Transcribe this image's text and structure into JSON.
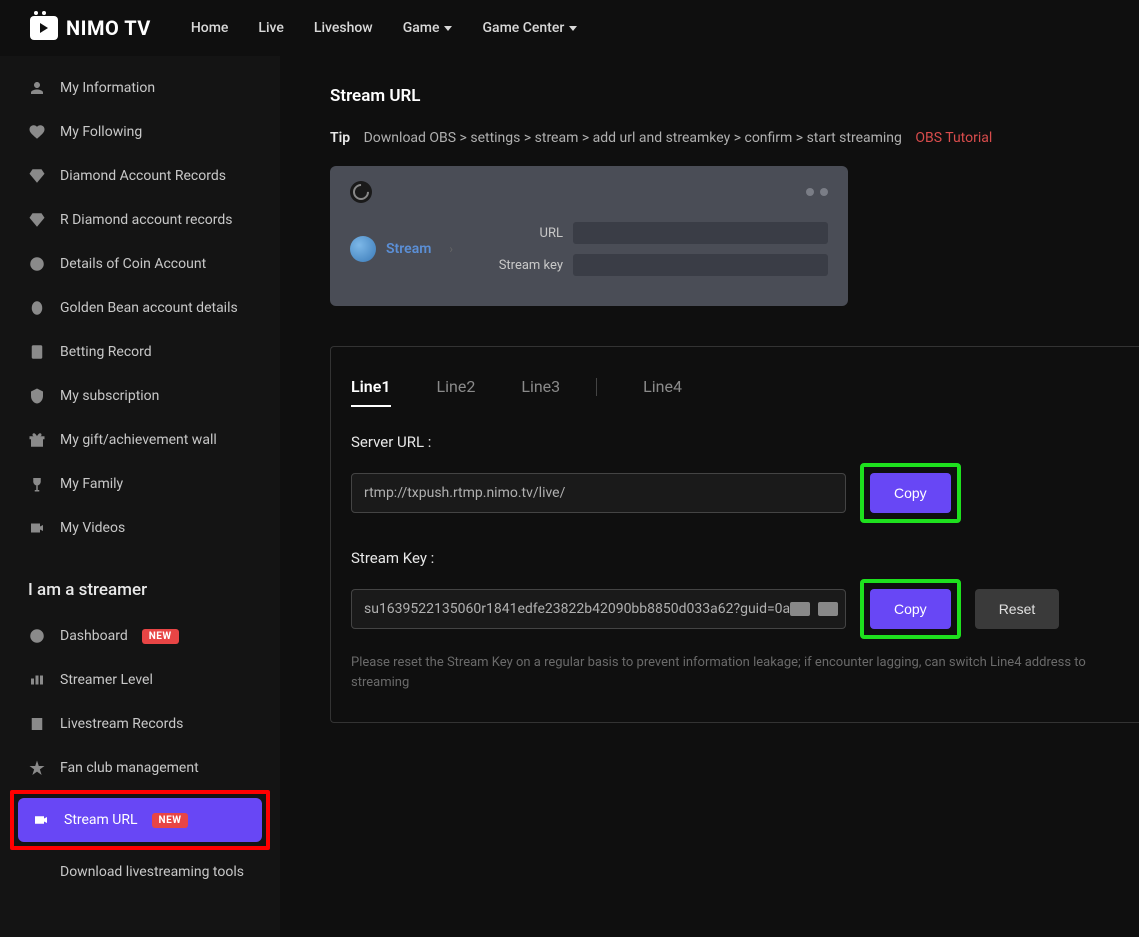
{
  "brand": "NIMO TV",
  "nav": {
    "home": "Home",
    "live": "Live",
    "liveshow": "Liveshow",
    "game": "Game",
    "game_center": "Game Center"
  },
  "sidebar": {
    "items": [
      {
        "label": "My Information"
      },
      {
        "label": "My Following"
      },
      {
        "label": "Diamond Account Records"
      },
      {
        "label": "R Diamond account records"
      },
      {
        "label": "Details of Coin Account"
      },
      {
        "label": "Golden Bean account details"
      },
      {
        "label": "Betting Record"
      },
      {
        "label": "My subscription"
      },
      {
        "label": "My gift/achievement wall"
      },
      {
        "label": "My Family"
      },
      {
        "label": "My Videos"
      }
    ],
    "section_title": "I am a streamer",
    "streamer_items": [
      {
        "label": "Dashboard",
        "badge": "NEW"
      },
      {
        "label": "Streamer Level"
      },
      {
        "label": "Livestream Records"
      },
      {
        "label": "Fan club management"
      },
      {
        "label": "Stream URL",
        "badge": "NEW",
        "active": true
      },
      {
        "label": "Download livestreaming tools"
      }
    ]
  },
  "page": {
    "title": "Stream URL",
    "tip_label": "Tip",
    "tip_text": "Download OBS > settings > stream > add url and streamkey > confirm > start streaming",
    "obs_link": "OBS Tutorial"
  },
  "obs_preview": {
    "tab": "Stream",
    "url_label": "URL",
    "key_label": "Stream key"
  },
  "tabs": [
    "Line1",
    "Line2",
    "Line3",
    "Line4"
  ],
  "active_tab": "Line1",
  "server_url": {
    "label": "Server URL :",
    "value": "rtmp://txpush.rtmp.nimo.tv/live/",
    "copy": "Copy"
  },
  "stream_key": {
    "label": "Stream Key :",
    "value": "su1639522135060r1841edfe23822b42090bb8850d033a62?guid=0a",
    "copy": "Copy",
    "reset": "Reset"
  },
  "hint": "Please reset the Stream Key on a regular basis to prevent information leakage; if encounter lagging, can switch Line4 address to streaming"
}
